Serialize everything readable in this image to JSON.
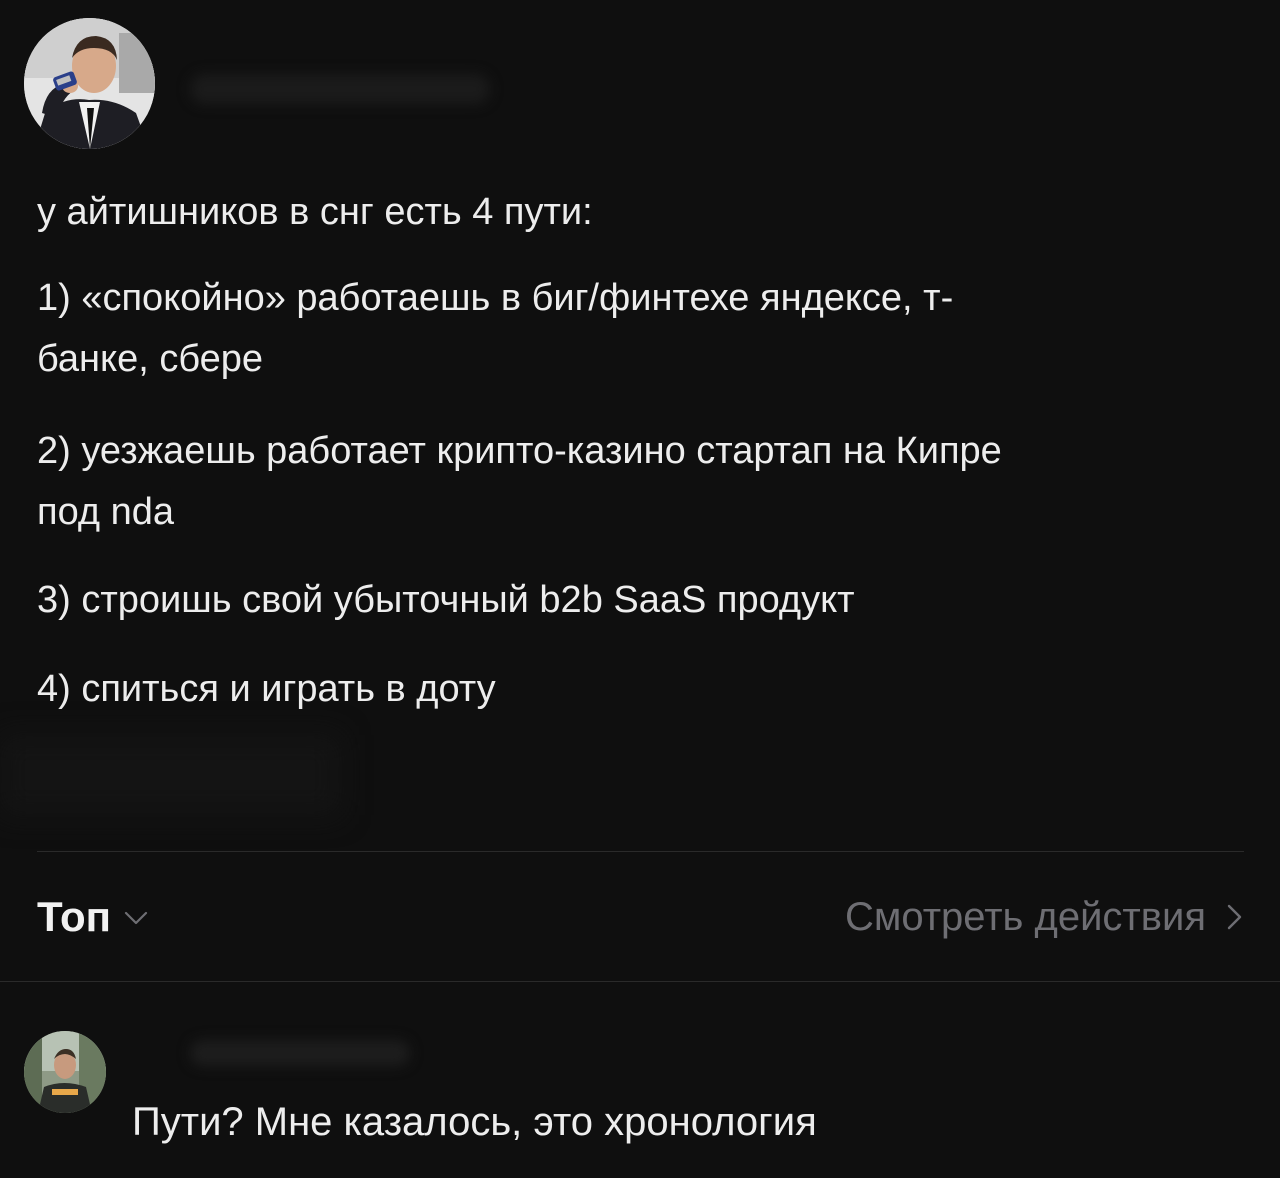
{
  "post": {
    "intro": "у айтишников в снг есть 4 пути:",
    "items": [
      {
        "line1": "1) «спокойно» работаешь в биг/финтехе яндексе, т-",
        "line2": "банке, сбере"
      },
      {
        "line1": "2) уезжаешь работает крипто-казино стартап на Кипре",
        "line2": "под nda"
      },
      {
        "line1": "3) строишь свой убыточный b2b SaaS продукт"
      },
      {
        "line1": "4) спиться и играть в доту"
      }
    ]
  },
  "sort": {
    "label": "Топ",
    "icon": "chevron-down-icon"
  },
  "actions": {
    "label": "Смотреть действия",
    "icon": "chevron-right-icon"
  },
  "comment": {
    "text": "Пути? Мне казалось, это хронология"
  },
  "colors": {
    "background": "#0f0f0f",
    "text": "#ededed",
    "muted": "#6e6e73",
    "divider": "#2a2a2a"
  }
}
